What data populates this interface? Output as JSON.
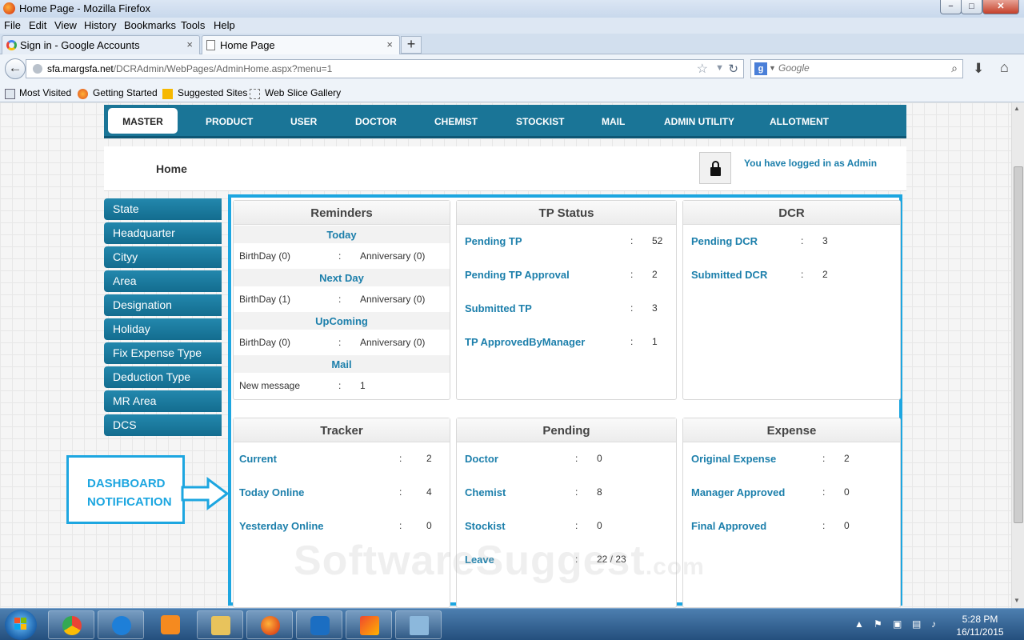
{
  "window": {
    "title": "Home Page - Mozilla Firefox",
    "controls": [
      "−",
      "□",
      "✕"
    ]
  },
  "menubar": [
    "File",
    "Edit",
    "View",
    "History",
    "Bookmarks",
    "Tools",
    "Help"
  ],
  "tabs": [
    {
      "label": "Sign in - Google Accounts",
      "close": "×"
    },
    {
      "label": "Home Page",
      "close": "×"
    }
  ],
  "new_tab": "+",
  "nav": {
    "url_domain": "sfa.margsfa.net",
    "url_path": "/DCRAdmin/WebPages/AdminHome.aspx?menu=1",
    "search_placeholder": "Google"
  },
  "bookmarks": [
    "Most Visited",
    "Getting Started",
    "Suggested Sites",
    "Web Slice Gallery"
  ],
  "app": {
    "topnav": [
      "MASTER",
      "PRODUCT",
      "USER",
      "DOCTOR",
      "CHEMIST",
      "STOCKIST",
      "MAIL",
      "ADMIN UTILITY",
      "ALLOTMENT"
    ],
    "page_title": "Home",
    "logged_in": "You have logged in as Admin",
    "sidebar": [
      "State",
      "Headquarter",
      "Cityy",
      "Area",
      "Designation",
      "Holiday",
      "Fix Expense Type",
      "Deduction Type",
      "MR Area",
      "DCS"
    ]
  },
  "reminders": {
    "title": "Reminders",
    "colon": ":",
    "today": {
      "heading": "Today",
      "birthday": "BirthDay (0)",
      "anniversary": "Anniversary (0)"
    },
    "next_day": {
      "heading": "Next Day",
      "birthday": "BirthDay (1)",
      "anniversary": "Anniversary (0)"
    },
    "upcoming": {
      "heading": "UpComing",
      "birthday": "BirthDay (0)",
      "anniversary": "Anniversary (0)"
    },
    "mail": {
      "heading": "Mail",
      "label": "New message",
      "value": "1"
    }
  },
  "tp_status": {
    "title": "TP Status",
    "rows": [
      {
        "label": "Pending TP",
        "colon": ":",
        "value": "52"
      },
      {
        "label": "Pending TP Approval",
        "colon": ":",
        "value": "2"
      },
      {
        "label": "Submitted TP",
        "colon": ":",
        "value": "3"
      },
      {
        "label": "TP ApprovedByManager",
        "colon": ":",
        "value": "1"
      }
    ]
  },
  "dcr": {
    "title": "DCR",
    "rows": [
      {
        "label": "Pending DCR",
        "colon": ":",
        "value": "3"
      },
      {
        "label": "Submitted DCR",
        "colon": ":",
        "value": "2"
      }
    ]
  },
  "tracker": {
    "title": "Tracker",
    "rows": [
      {
        "label": "Current",
        "colon": ":",
        "value": "2"
      },
      {
        "label": "Today Online",
        "colon": ":",
        "value": "4"
      },
      {
        "label": "Yesterday Online",
        "colon": ":",
        "value": "0"
      }
    ]
  },
  "pending": {
    "title": "Pending",
    "rows": [
      {
        "label": "Doctor",
        "colon": ":",
        "value": "0"
      },
      {
        "label": "Chemist",
        "colon": ":",
        "value": "8"
      },
      {
        "label": "Stockist",
        "colon": ":",
        "value": "0"
      },
      {
        "label": "Leave",
        "colon": ":",
        "value": "22 / 23"
      }
    ]
  },
  "expense": {
    "title": "Expense",
    "rows": [
      {
        "label": "Original Expense",
        "colon": ":",
        "value": "2"
      },
      {
        "label": "Manager Approved",
        "colon": ":",
        "value": "0"
      },
      {
        "label": "Final Approved",
        "colon": ":",
        "value": "0"
      }
    ]
  },
  "callout": {
    "line1": "DASHBOARD",
    "line2": "NOTIFICATION"
  },
  "watermark": {
    "main": "SoftwareSuggest",
    "suffix": ".com"
  },
  "taskbar": {
    "time": "5:28 PM",
    "date": "16/11/2015"
  },
  "colors": {
    "accent": "#1a7597",
    "link": "#1c7fab",
    "highlight": "#1da6e0"
  }
}
